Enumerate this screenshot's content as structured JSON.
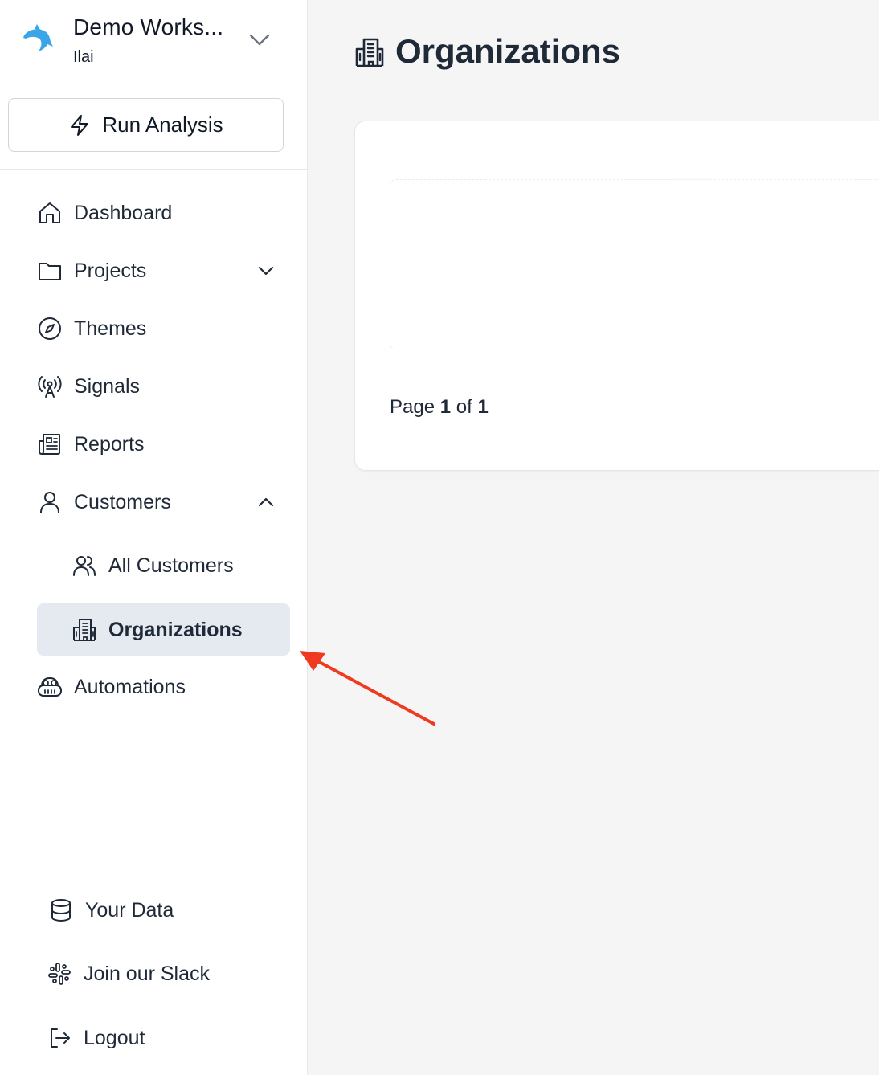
{
  "workspace": {
    "name": "Demo Works...",
    "user": "Ilai",
    "logo_icon": "dolphin-logo",
    "logo_color": "#3aa6e8"
  },
  "sidebar": {
    "run_button": {
      "label": "Run Analysis",
      "icon": "lightning-icon"
    },
    "items": [
      {
        "label": "Dashboard",
        "icon": "home-icon"
      },
      {
        "label": "Projects",
        "icon": "folder-icon",
        "expandable": true,
        "expanded": false
      },
      {
        "label": "Themes",
        "icon": "compass-icon"
      },
      {
        "label": "Signals",
        "icon": "antenna-icon"
      },
      {
        "label": "Reports",
        "icon": "newspaper-icon"
      },
      {
        "label": "Customers",
        "icon": "user-icon",
        "expandable": true,
        "expanded": true
      },
      {
        "label": "All Customers",
        "icon": "users-icon",
        "sub": true
      },
      {
        "label": "Organizations",
        "icon": "building-icon",
        "sub": true,
        "active": true
      },
      {
        "label": "Automations",
        "icon": "robot-icon"
      }
    ],
    "footer": [
      {
        "label": "Your Data",
        "icon": "database-icon"
      },
      {
        "label": "Join our Slack",
        "icon": "slack-icon"
      },
      {
        "label": "Logout",
        "icon": "logout-icon"
      }
    ]
  },
  "main": {
    "title": "Organizations",
    "title_icon": "building-icon",
    "pager": {
      "prefix": "Page",
      "current": "1",
      "of": "of",
      "total": "1"
    }
  },
  "colors": {
    "active_bg": "#e5e9f0",
    "annotation_arrow": "#f03a1f"
  }
}
